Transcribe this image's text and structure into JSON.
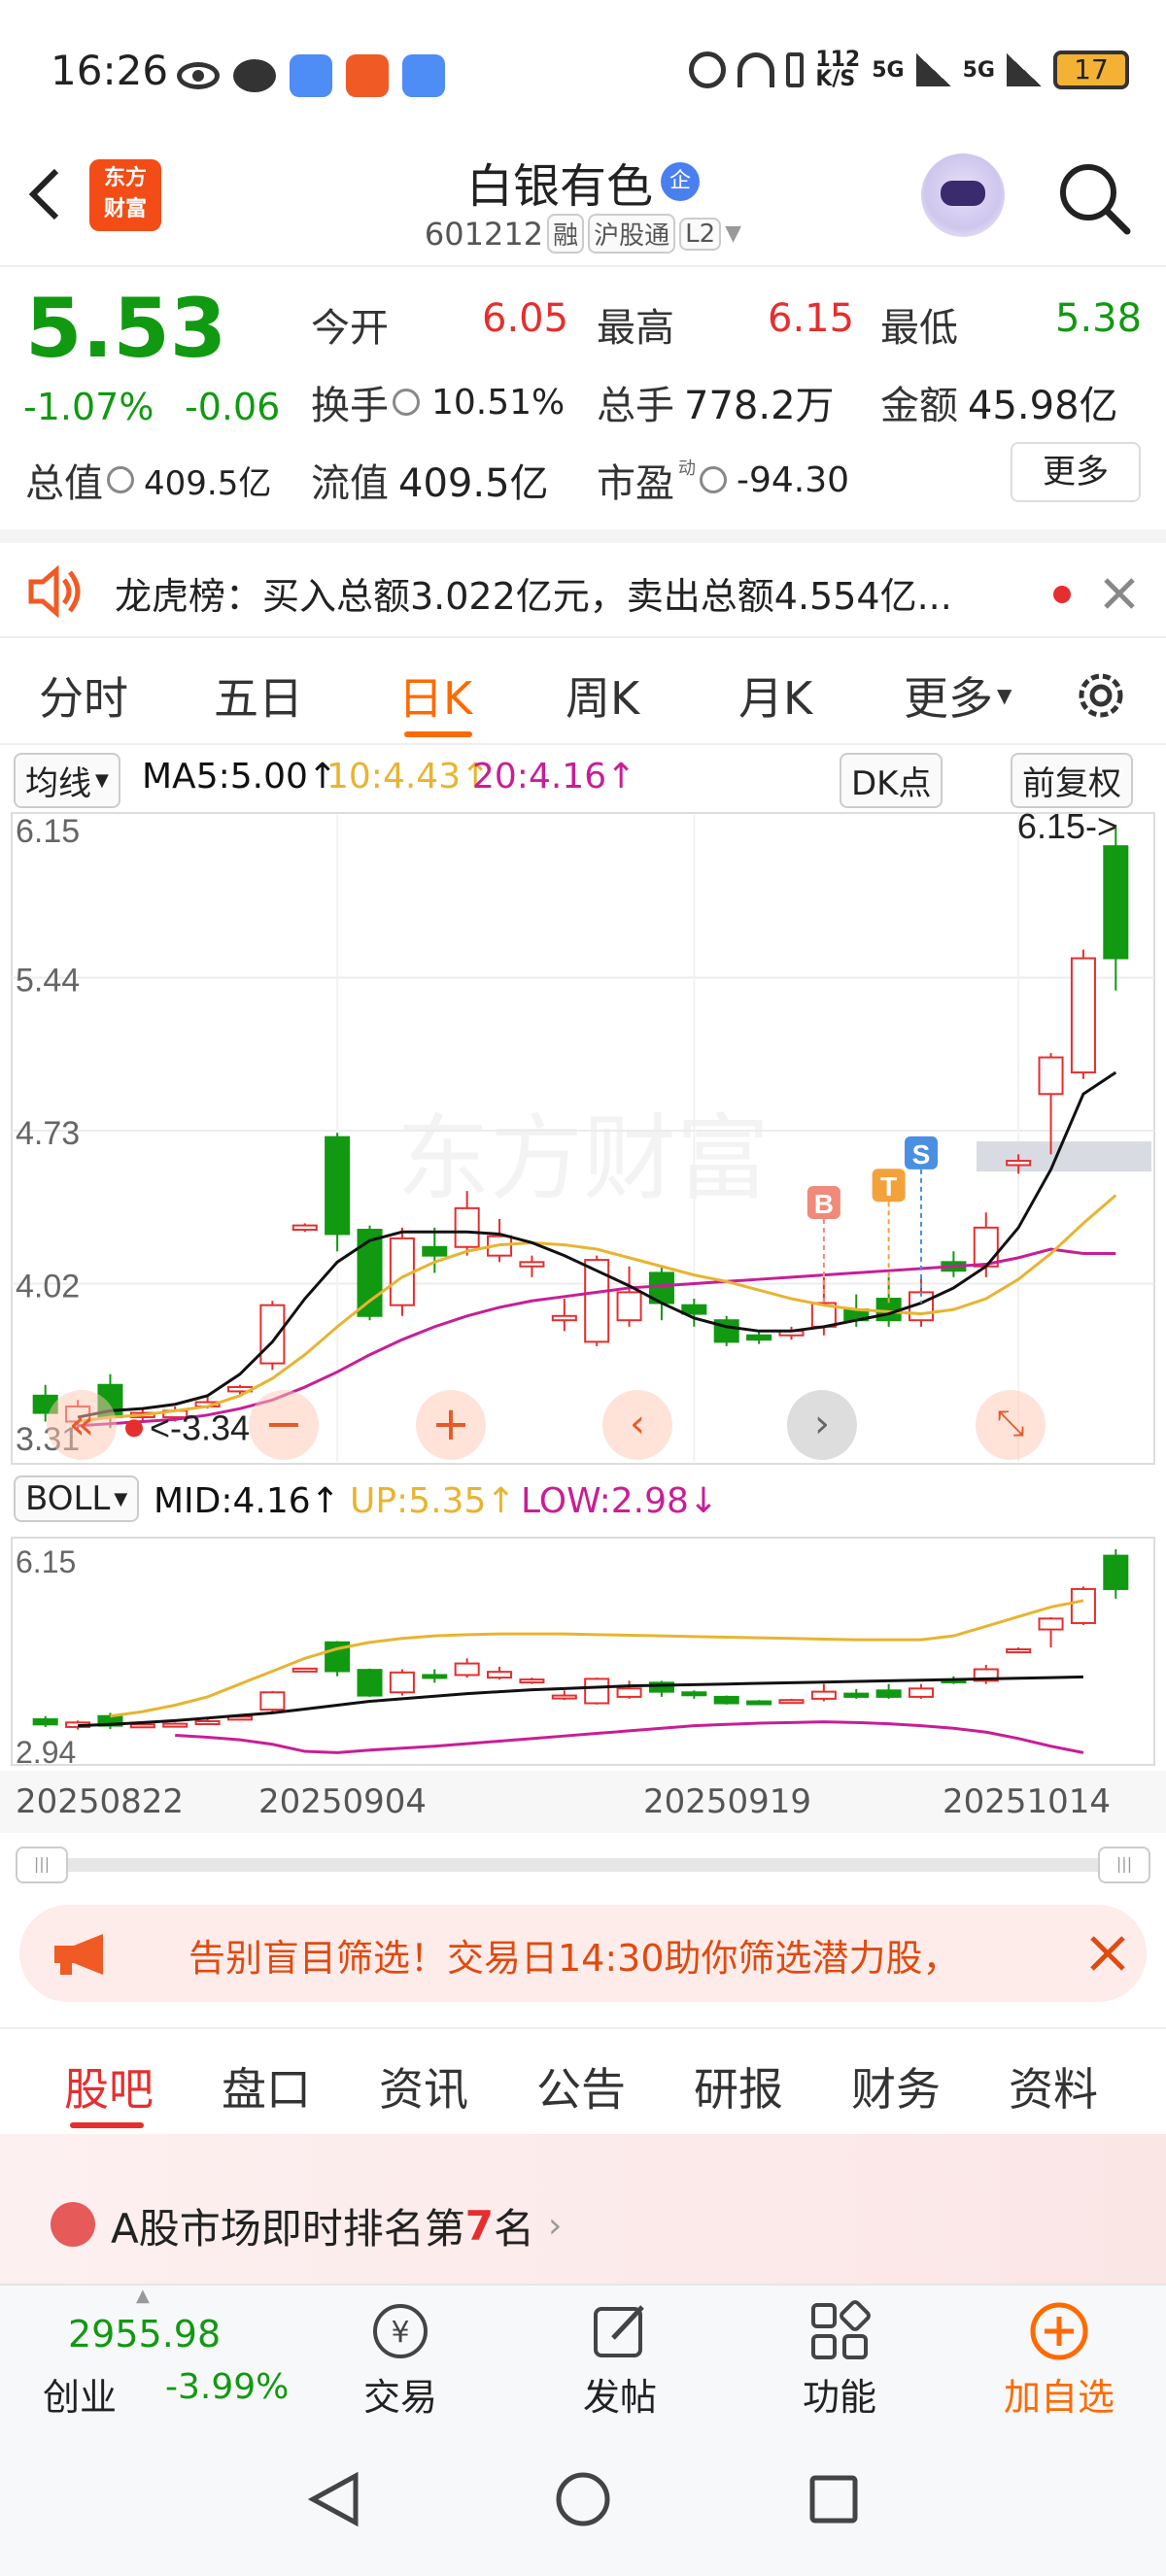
{
  "status_bar": {
    "time": "16:26",
    "net_speed_top": "112",
    "net_speed_bottom": "K/S",
    "signal1": "5G",
    "signal2": "5G",
    "battery": "17"
  },
  "header": {
    "title": "白银有色",
    "title_badge": "企",
    "code": "601212",
    "tag1": "融",
    "tag2": "沪股通",
    "tag3": "L2",
    "logo_line1": "东方",
    "logo_line2": "财富"
  },
  "quote": {
    "price": "5.53",
    "change_pct": "-1.07%",
    "change": "-0.06",
    "open_label": "今开",
    "open": "6.05",
    "high_label": "最高",
    "high": "6.15",
    "low_label": "最低",
    "low": "5.38",
    "turnover_label": "换手",
    "turnover": "10.51%",
    "volume_label": "总手",
    "volume": "778.2万",
    "amount_label": "金额",
    "amount": "45.98亿",
    "mktcap_label": "总值",
    "mktcap": "409.5亿",
    "float_label": "流值",
    "float": "409.5亿",
    "pe_label": "市盈",
    "pe_sup": "动",
    "pe": "-94.30",
    "more_button": "更多"
  },
  "news": {
    "text": "龙虎榜：买入总额3.022亿元，卖出总额4.554亿..."
  },
  "period_tabs": [
    {
      "label": "分时"
    },
    {
      "label": "五日"
    },
    {
      "label": "日K"
    },
    {
      "label": "周K"
    },
    {
      "label": "月K"
    },
    {
      "label": "更多"
    }
  ],
  "chart_controls": {
    "ma_select": "均线",
    "ma5": "MA5:5.00↑",
    "ma10": "10:4.43↑",
    "ma20": "20:4.16↑",
    "dk_button": "DK点",
    "fq_button": "前复权"
  },
  "boll_controls": {
    "select": "BOLL",
    "mid": "MID:4.16↑",
    "up": "UP:5.35↑",
    "low": "LOW:2.98↓"
  },
  "colors": {
    "up": "#e62e2e",
    "down": "#119911",
    "accent": "#ff6a00",
    "ma5": "#111111",
    "ma10": "#e8b430",
    "ma20": "#c81e96"
  },
  "chart_data": {
    "type": "candlestick",
    "x_tick_labels": [
      "20250822",
      "20250904",
      "20250919",
      "20251014"
    ],
    "main": {
      "y_tick_labels": [
        "6.15",
        "5.44",
        "4.73",
        "4.02",
        "3.31"
      ],
      "ylim": [
        3.31,
        6.15
      ],
      "high_annotation": "6.15->",
      "low_annotation": "<-3.34",
      "markers": [
        "B",
        "T",
        "S"
      ],
      "watermark": "东方财富",
      "candles": [
        {
          "o": 3.5,
          "c": 3.42,
          "h": 3.55,
          "l": 3.38
        },
        {
          "o": 3.38,
          "c": 3.45,
          "h": 3.48,
          "l": 3.34
        },
        {
          "o": 3.55,
          "c": 3.4,
          "h": 3.6,
          "l": 3.35
        },
        {
          "o": 3.4,
          "c": 3.42,
          "h": 3.44,
          "l": 3.38
        },
        {
          "o": 3.4,
          "c": 3.43,
          "h": 3.45,
          "l": 3.38
        },
        {
          "o": 3.45,
          "c": 3.47,
          "h": 3.5,
          "l": 3.44
        },
        {
          "o": 3.52,
          "c": 3.54,
          "h": 3.55,
          "l": 3.5
        },
        {
          "o": 3.65,
          "c": 3.92,
          "h": 3.94,
          "l": 3.62
        },
        {
          "o": 4.27,
          "c": 4.29,
          "h": 4.3,
          "l": 4.26
        },
        {
          "o": 4.7,
          "c": 4.25,
          "h": 4.72,
          "l": 4.17
        },
        {
          "o": 4.27,
          "c": 3.87,
          "h": 4.29,
          "l": 3.85
        },
        {
          "o": 3.92,
          "c": 4.23,
          "h": 4.28,
          "l": 3.87
        },
        {
          "o": 4.19,
          "c": 4.15,
          "h": 4.28,
          "l": 4.07
        },
        {
          "o": 4.19,
          "c": 4.37,
          "h": 4.45,
          "l": 4.15
        },
        {
          "o": 4.15,
          "c": 4.24,
          "h": 4.32,
          "l": 4.12
        },
        {
          "o": 4.1,
          "c": 4.12,
          "h": 4.15,
          "l": 4.05
        },
        {
          "o": 3.85,
          "c": 3.87,
          "h": 3.95,
          "l": 3.8
        },
        {
          "o": 3.75,
          "c": 4.13,
          "h": 4.15,
          "l": 3.73
        },
        {
          "o": 3.85,
          "c": 3.98,
          "h": 4.1,
          "l": 3.82
        },
        {
          "o": 4.07,
          "c": 3.93,
          "h": 4.1,
          "l": 3.85
        },
        {
          "o": 3.92,
          "c": 3.88,
          "h": 3.95,
          "l": 3.82
        },
        {
          "o": 3.85,
          "c": 3.75,
          "h": 3.87,
          "l": 3.73
        },
        {
          "o": 3.78,
          "c": 3.76,
          "h": 3.8,
          "l": 3.74
        },
        {
          "o": 3.78,
          "c": 3.8,
          "h": 3.82,
          "l": 3.76
        },
        {
          "o": 3.82,
          "c": 3.93,
          "h": 4.05,
          "l": 3.78
        },
        {
          "o": 3.9,
          "c": 3.85,
          "h": 3.97,
          "l": 3.82
        },
        {
          "o": 3.95,
          "c": 3.85,
          "h": 4.05,
          "l": 3.82
        },
        {
          "o": 3.85,
          "c": 3.98,
          "h": 4.05,
          "l": 3.82
        },
        {
          "o": 4.12,
          "c": 4.08,
          "h": 4.17,
          "l": 4.05
        },
        {
          "o": 4.1,
          "c": 4.28,
          "h": 4.35,
          "l": 4.05
        },
        {
          "o": 4.57,
          "c": 4.59,
          "h": 4.62,
          "l": 4.53
        },
        {
          "o": 4.9,
          "c": 5.07,
          "h": 5.09,
          "l": 4.62
        },
        {
          "o": 5.0,
          "c": 5.53,
          "h": 5.57,
          "l": 4.97
        },
        {
          "o": 6.05,
          "c": 5.53,
          "h": 6.15,
          "l": 5.38
        }
      ],
      "ma5": [
        3.4,
        3.43,
        3.44,
        3.46,
        3.5,
        3.6,
        3.75,
        3.95,
        4.12,
        4.22,
        4.26,
        4.26,
        4.26,
        4.25,
        4.21,
        4.15,
        4.08,
        4.01,
        3.93,
        3.86,
        3.82,
        3.8,
        3.8,
        3.82,
        3.85,
        3.88,
        3.93,
        4.0,
        4.1,
        4.28,
        4.55,
        4.9,
        5.0
      ],
      "ma10": [
        3.38,
        3.4,
        3.41,
        3.43,
        3.45,
        3.5,
        3.58,
        3.69,
        3.82,
        3.94,
        4.05,
        4.12,
        4.17,
        4.2,
        4.21,
        4.2,
        4.18,
        4.14,
        4.1,
        4.06,
        4.03,
        3.99,
        3.95,
        3.92,
        3.9,
        3.89,
        3.88,
        3.9,
        3.95,
        4.04,
        4.16,
        4.3,
        4.43
      ],
      "ma20": [
        3.36,
        3.37,
        3.38,
        3.39,
        3.41,
        3.44,
        3.48,
        3.54,
        3.61,
        3.69,
        3.76,
        3.82,
        3.87,
        3.91,
        3.94,
        3.96,
        3.98,
        4.0,
        4.01,
        4.02,
        4.03,
        4.04,
        4.05,
        4.06,
        4.07,
        4.08,
        4.09,
        4.1,
        4.11,
        4.14,
        4.18,
        4.16,
        4.16
      ]
    },
    "boll": {
      "y_tick_labels": [
        "6.15",
        "2.94"
      ],
      "ylim": [
        2.94,
        6.15
      ],
      "mid": [
        3.4,
        3.42,
        3.45,
        3.48,
        3.52,
        3.56,
        3.6,
        3.66,
        3.72,
        3.78,
        3.82,
        3.86,
        3.9,
        3.93,
        3.96,
        3.98,
        4.0,
        4.02,
        4.03,
        4.04,
        4.05,
        4.06,
        4.07,
        4.08,
        4.09,
        4.1,
        4.11,
        4.12,
        4.13,
        4.14,
        4.15,
        4.16
      ],
      "up": [
        3.55,
        3.62,
        3.72,
        3.85,
        4.05,
        4.25,
        4.45,
        4.6,
        4.7,
        4.76,
        4.8,
        4.82,
        4.83,
        4.83,
        4.83,
        4.82,
        4.81,
        4.8,
        4.79,
        4.78,
        4.77,
        4.76,
        4.75,
        4.74,
        4.74,
        4.74,
        4.8,
        4.95,
        5.1,
        5.25,
        5.35
      ],
      "low": [
        3.25,
        3.22,
        3.18,
        3.11,
        3.0,
        2.98,
        3.02,
        3.05,
        3.08,
        3.12,
        3.16,
        3.2,
        3.24,
        3.28,
        3.32,
        3.36,
        3.4,
        3.42,
        3.44,
        3.45,
        3.46,
        3.45,
        3.43,
        3.4,
        3.36,
        3.3,
        3.2,
        3.08,
        2.98
      ]
    }
  },
  "banner": {
    "text": "告别盲目筛选！交易日14:30助你筛选潜力股，"
  },
  "section_tabs": [
    {
      "label": "股吧"
    },
    {
      "label": "盘口"
    },
    {
      "label": "资讯"
    },
    {
      "label": "公告"
    },
    {
      "label": "研报"
    },
    {
      "label": "财务"
    },
    {
      "label": "资料"
    }
  ],
  "rank": {
    "prefix": "A股市场即时排名第",
    "number": "7",
    "suffix": "名"
  },
  "bottom_bar": {
    "index_value": "2955.98",
    "index_name": "创业",
    "index_change": "-3.99%",
    "trade": "交易",
    "post": "发帖",
    "functions": "功能",
    "add_watch": "加自选"
  }
}
